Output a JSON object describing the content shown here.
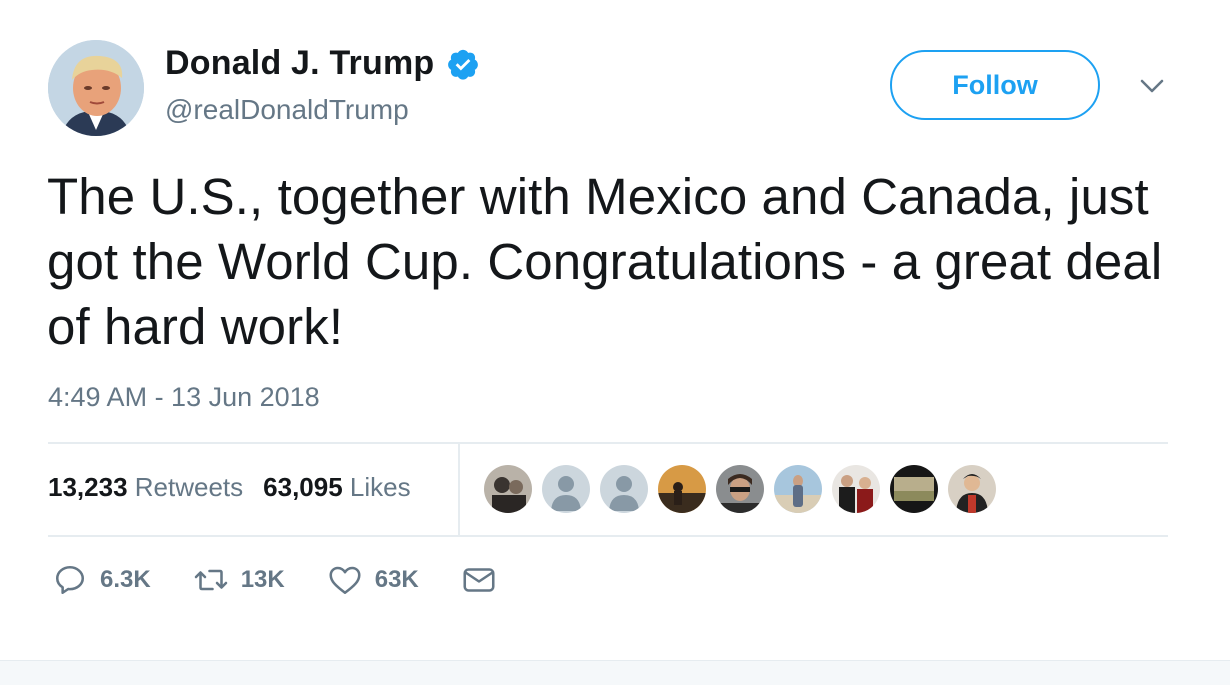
{
  "author": {
    "name": "Donald J. Trump",
    "handle": "@realDonaldTrump",
    "verified": true
  },
  "follow_button": {
    "label": "Follow"
  },
  "tweet": {
    "text": "The U.S., together with Mexico and Canada, just got the World Cup. Congratulations - a great deal of hard work!",
    "timestamp": "4:49 AM - 13 Jun 2018"
  },
  "stats": {
    "retweets": {
      "count": "13,233",
      "label": "Retweets"
    },
    "likes": {
      "count": "63,095",
      "label": "Likes"
    }
  },
  "likers": [
    {
      "kind": "photo",
      "icon": "user-photo"
    },
    {
      "kind": "default",
      "icon": "default-avatar"
    },
    {
      "kind": "default",
      "icon": "default-avatar"
    },
    {
      "kind": "photo",
      "icon": "sunset-photo"
    },
    {
      "kind": "photo",
      "icon": "user-photo"
    },
    {
      "kind": "photo",
      "icon": "beach-photo"
    },
    {
      "kind": "photo",
      "icon": "graduation-photo"
    },
    {
      "kind": "photo",
      "icon": "landscape-photo"
    },
    {
      "kind": "photo",
      "icon": "user-photo"
    }
  ],
  "actions": {
    "reply": {
      "count": "6.3K",
      "icon": "reply-icon"
    },
    "retweet": {
      "count": "13K",
      "icon": "retweet-icon"
    },
    "like": {
      "count": "63K",
      "icon": "heart-icon"
    },
    "message": {
      "icon": "envelope-icon"
    }
  },
  "colors": {
    "accent": "#1da1f2",
    "text": "#14171a",
    "secondary": "#657786",
    "divider": "#e6ecf0"
  }
}
